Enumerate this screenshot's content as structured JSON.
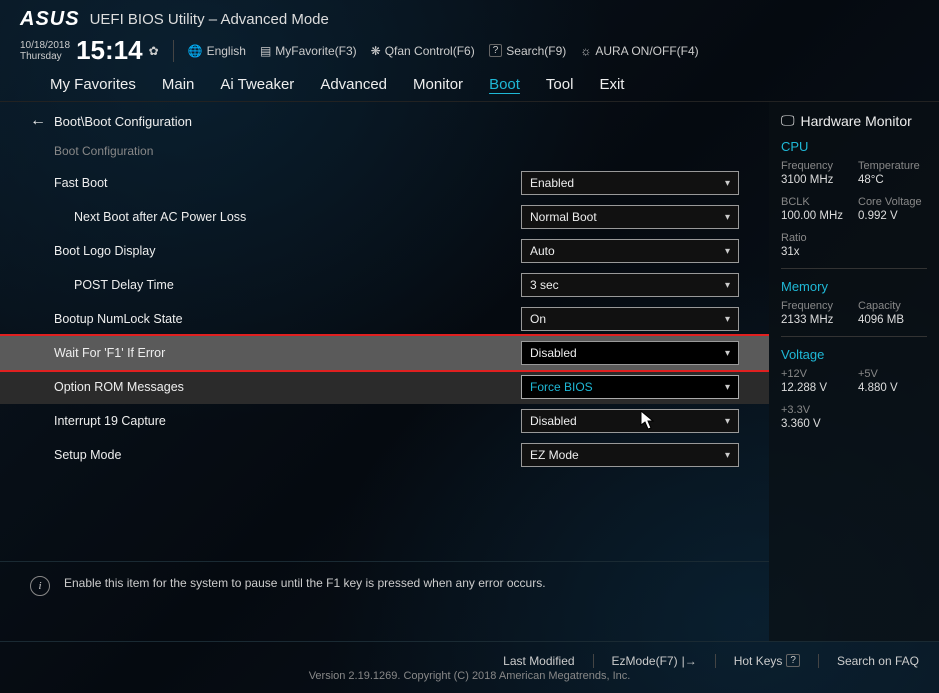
{
  "header": {
    "logo": "ASUS",
    "title": "UEFI BIOS Utility – Advanced Mode",
    "date": "10/18/2018",
    "day": "Thursday",
    "time": "15:14",
    "language": "English",
    "myfavorite": "MyFavorite(F3)",
    "qfan": "Qfan Control(F6)",
    "search": "Search(F9)",
    "aura": "AURA ON/OFF(F4)"
  },
  "menu": {
    "items": [
      "My Favorites",
      "Main",
      "Ai Tweaker",
      "Advanced",
      "Monitor",
      "Boot",
      "Tool",
      "Exit"
    ],
    "active_index": 5
  },
  "breadcrumb": "Boot\\Boot Configuration",
  "section_title": "Boot Configuration",
  "settings": [
    {
      "label": "Fast Boot",
      "value": "Enabled",
      "indent": false
    },
    {
      "label": "Next Boot after AC Power Loss",
      "value": "Normal Boot",
      "indent": true
    },
    {
      "label": "Boot Logo Display",
      "value": "Auto",
      "indent": false
    },
    {
      "label": "POST Delay Time",
      "value": "3 sec",
      "indent": true
    },
    {
      "label": "Bootup NumLock State",
      "value": "On",
      "indent": false
    },
    {
      "label": "Wait For 'F1' If Error",
      "value": "Disabled",
      "indent": false,
      "highlighted": true
    },
    {
      "label": "Option ROM Messages",
      "value": "Force BIOS",
      "indent": false,
      "hover": true,
      "active_value": true
    },
    {
      "label": "Interrupt 19 Capture",
      "value": "Disabled",
      "indent": false
    },
    {
      "label": "Setup Mode",
      "value": "EZ Mode",
      "indent": false
    }
  ],
  "help_text": "Enable this item for the system to pause until the F1 key is pressed when any error occurs.",
  "sidebar": {
    "title": "Hardware Monitor",
    "cpu": {
      "heading": "CPU",
      "freq_label": "Frequency",
      "freq": "3100 MHz",
      "temp_label": "Temperature",
      "temp": "48°C",
      "bclk_label": "BCLK",
      "bclk": "100.00 MHz",
      "volt_label": "Core Voltage",
      "volt": "0.992 V",
      "ratio_label": "Ratio",
      "ratio": "31x"
    },
    "memory": {
      "heading": "Memory",
      "freq_label": "Frequency",
      "freq": "2133 MHz",
      "cap_label": "Capacity",
      "cap": "4096 MB"
    },
    "voltage": {
      "heading": "Voltage",
      "v12_label": "+12V",
      "v12": "12.288 V",
      "v5_label": "+5V",
      "v5": "4.880 V",
      "v33_label": "+3.3V",
      "v33": "3.360 V"
    }
  },
  "footer": {
    "last_modified": "Last Modified",
    "ezmode": "EzMode(F7)",
    "hotkeys": "Hot Keys",
    "faq": "Search on FAQ",
    "version": "Version 2.19.1269. Copyright (C) 2018 American Megatrends, Inc."
  }
}
